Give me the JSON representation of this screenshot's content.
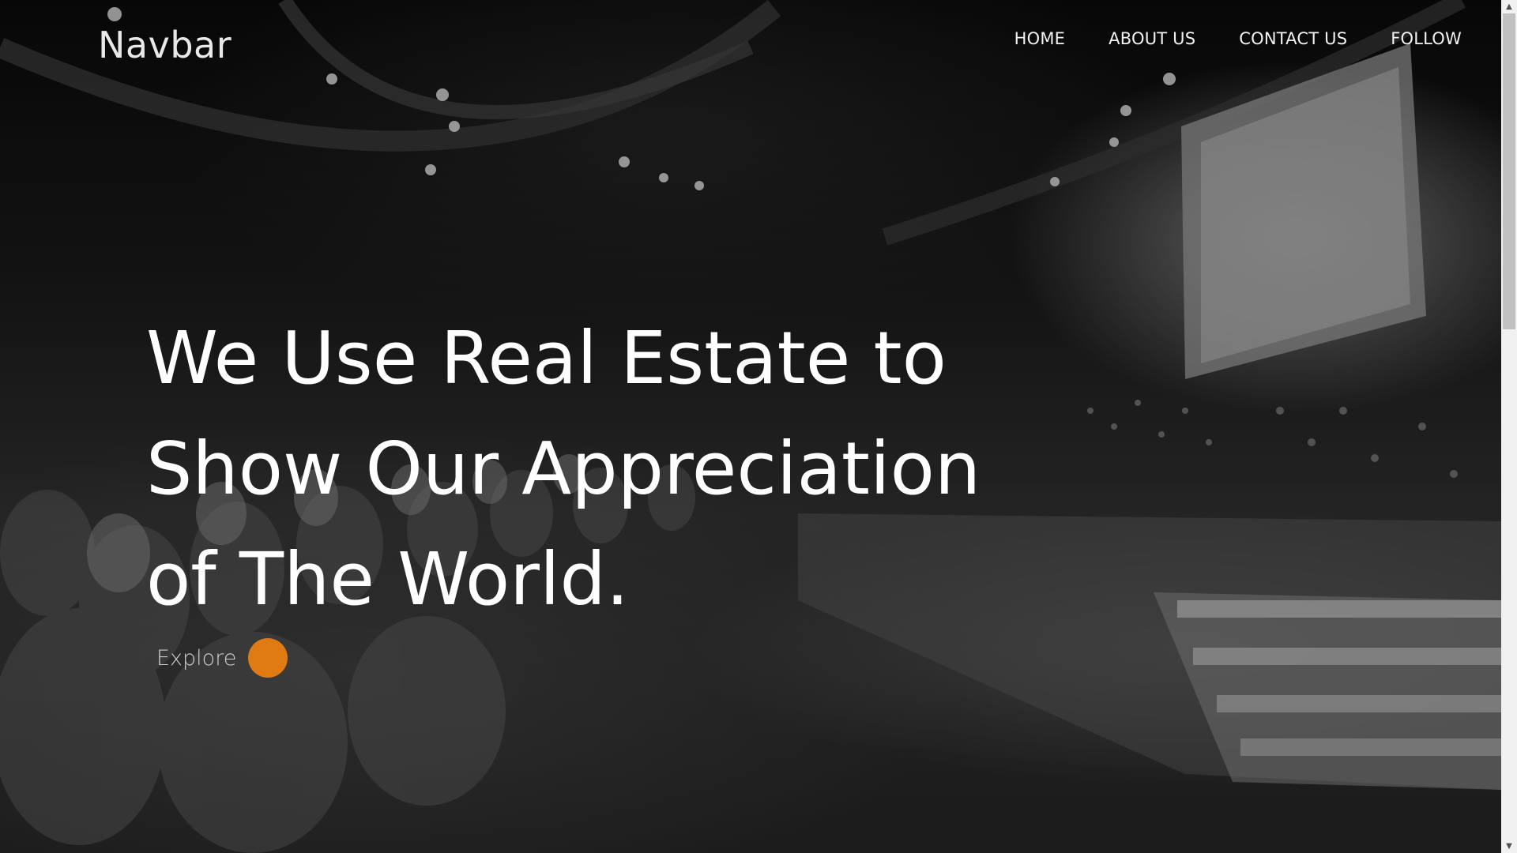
{
  "navbar": {
    "brand": "Navbar",
    "links": [
      {
        "label": "HOME"
      },
      {
        "label": "ABOUT US"
      },
      {
        "label": "CONTACT US"
      },
      {
        "label": "FOLLOW"
      }
    ]
  },
  "hero": {
    "headline_lines": [
      "We Use Real Estate to",
      "Show Our Appreciation",
      "of The World."
    ],
    "explore_label": "Explore",
    "accent_color": "#e07a12"
  },
  "scrollbar": {
    "up_arrow": "▲",
    "down_arrow": "▼"
  }
}
